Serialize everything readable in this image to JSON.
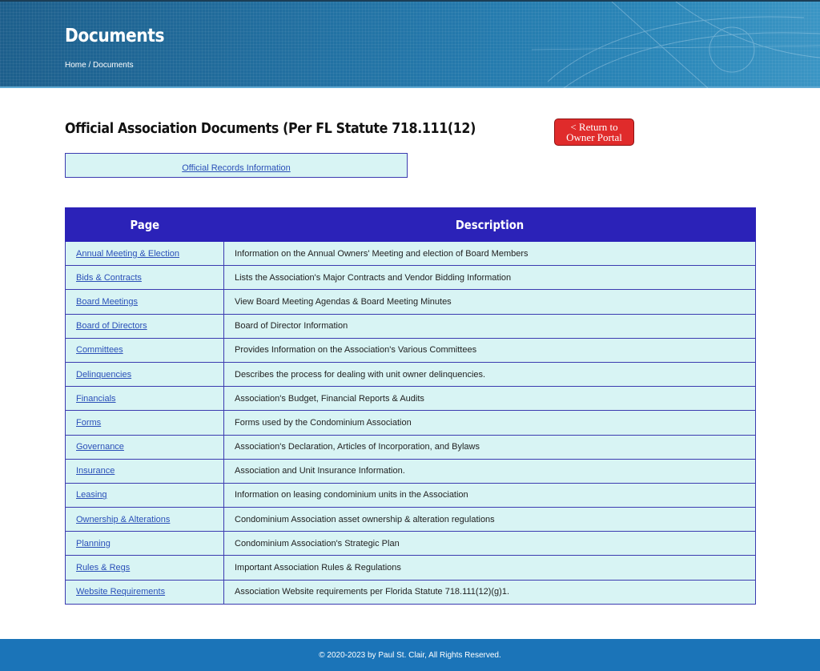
{
  "header": {
    "title": "Documents",
    "breadcrumb": {
      "home": "Home",
      "separator": "/",
      "current": "Documents"
    }
  },
  "main": {
    "heading": "Official Association Documents (Per FL Statute 718.111(12)",
    "return_button": {
      "line1": "< Return to",
      "line2": "Owner Portal"
    },
    "records_link": "Official Records Information",
    "table": {
      "columns": [
        "Page",
        "Description"
      ],
      "rows": [
        {
          "page": "Annual Meeting & Election",
          "description": "Information on the Annual Owners' Meeting and election of Board Members"
        },
        {
          "page": "Bids & Contracts",
          "description": "Lists the Association's Major Contracts and Vendor Bidding Information"
        },
        {
          "page": "Board Meetings",
          "description": "View Board Meeting Agendas & Board Meeting Minutes"
        },
        {
          "page": "Board of Directors",
          "description": "Board of Director Information"
        },
        {
          "page": "Committees",
          "description": "Provides Information on the Association's Various Committees"
        },
        {
          "page": "Delinquencies",
          "description": "Describes the process for dealing with unit owner delinquencies."
        },
        {
          "page": "Financials",
          "description": "Association's Budget, Financial Reports & Audits"
        },
        {
          "page": "Forms",
          "description": "Forms used by the Condominium Association"
        },
        {
          "page": "Governance",
          "description": "Association's Declaration, Articles of Incorporation, and Bylaws"
        },
        {
          "page": "Insurance",
          "description": "Association and Unit Insurance Information."
        },
        {
          "page": "Leasing",
          "description": "Information on leasing condominium units in the Association"
        },
        {
          "page": "Ownership & Alterations",
          "description": "Condominium Association asset ownership & alteration regulations"
        },
        {
          "page": "Planning",
          "description": "Condominium Association's Strategic Plan"
        },
        {
          "page": "Rules & Regs",
          "description": "Important Association Rules & Regulations"
        },
        {
          "page": "Website Requirements",
          "description": "Association Website requirements per Florida Statute 718.111(12)(g)1."
        }
      ]
    }
  },
  "footer": {
    "copyright": "© 2020-2023 by Paul St. Clair, All Rights Reserved."
  },
  "colors": {
    "header_blue": "#2478ab",
    "table_header": "#2b22b8",
    "cell_background": "#d8f4f4",
    "return_button": "#e02b2b",
    "footer_blue": "#1b74b8",
    "link": "#2a4fb8"
  }
}
